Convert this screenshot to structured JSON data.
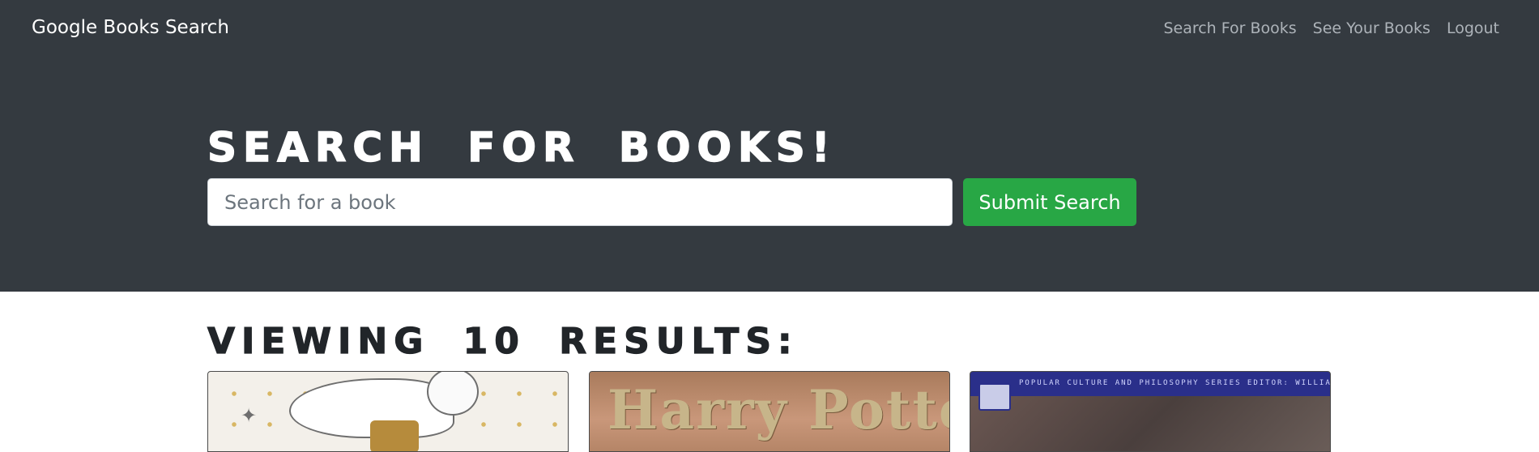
{
  "navbar": {
    "brand": "Google Books Search",
    "links": [
      {
        "label": "Search For Books"
      },
      {
        "label": "See Your Books"
      },
      {
        "label": "Logout"
      }
    ]
  },
  "hero": {
    "title": "Search for Books!",
    "search": {
      "placeholder": "Search for a book",
      "value": ""
    },
    "submit_label": "Submit Search"
  },
  "results": {
    "heading": "Viewing 10 results:",
    "cards": [
      {
        "image": "book-cover-owl-coloring-book"
      },
      {
        "image": "book-cover-harry-potter",
        "cover_text": "Harry Potter"
      },
      {
        "image": "book-cover-popular-culture-philosophy",
        "cover_text": "POPULAR CULTURE AND PHILOSOPHY SERIES EDITOR: WILLIAM IRWIN"
      }
    ]
  },
  "colors": {
    "navbar_bg": "#343a40",
    "submit_bg": "#28a745",
    "nav_link": "#adb3b9"
  }
}
